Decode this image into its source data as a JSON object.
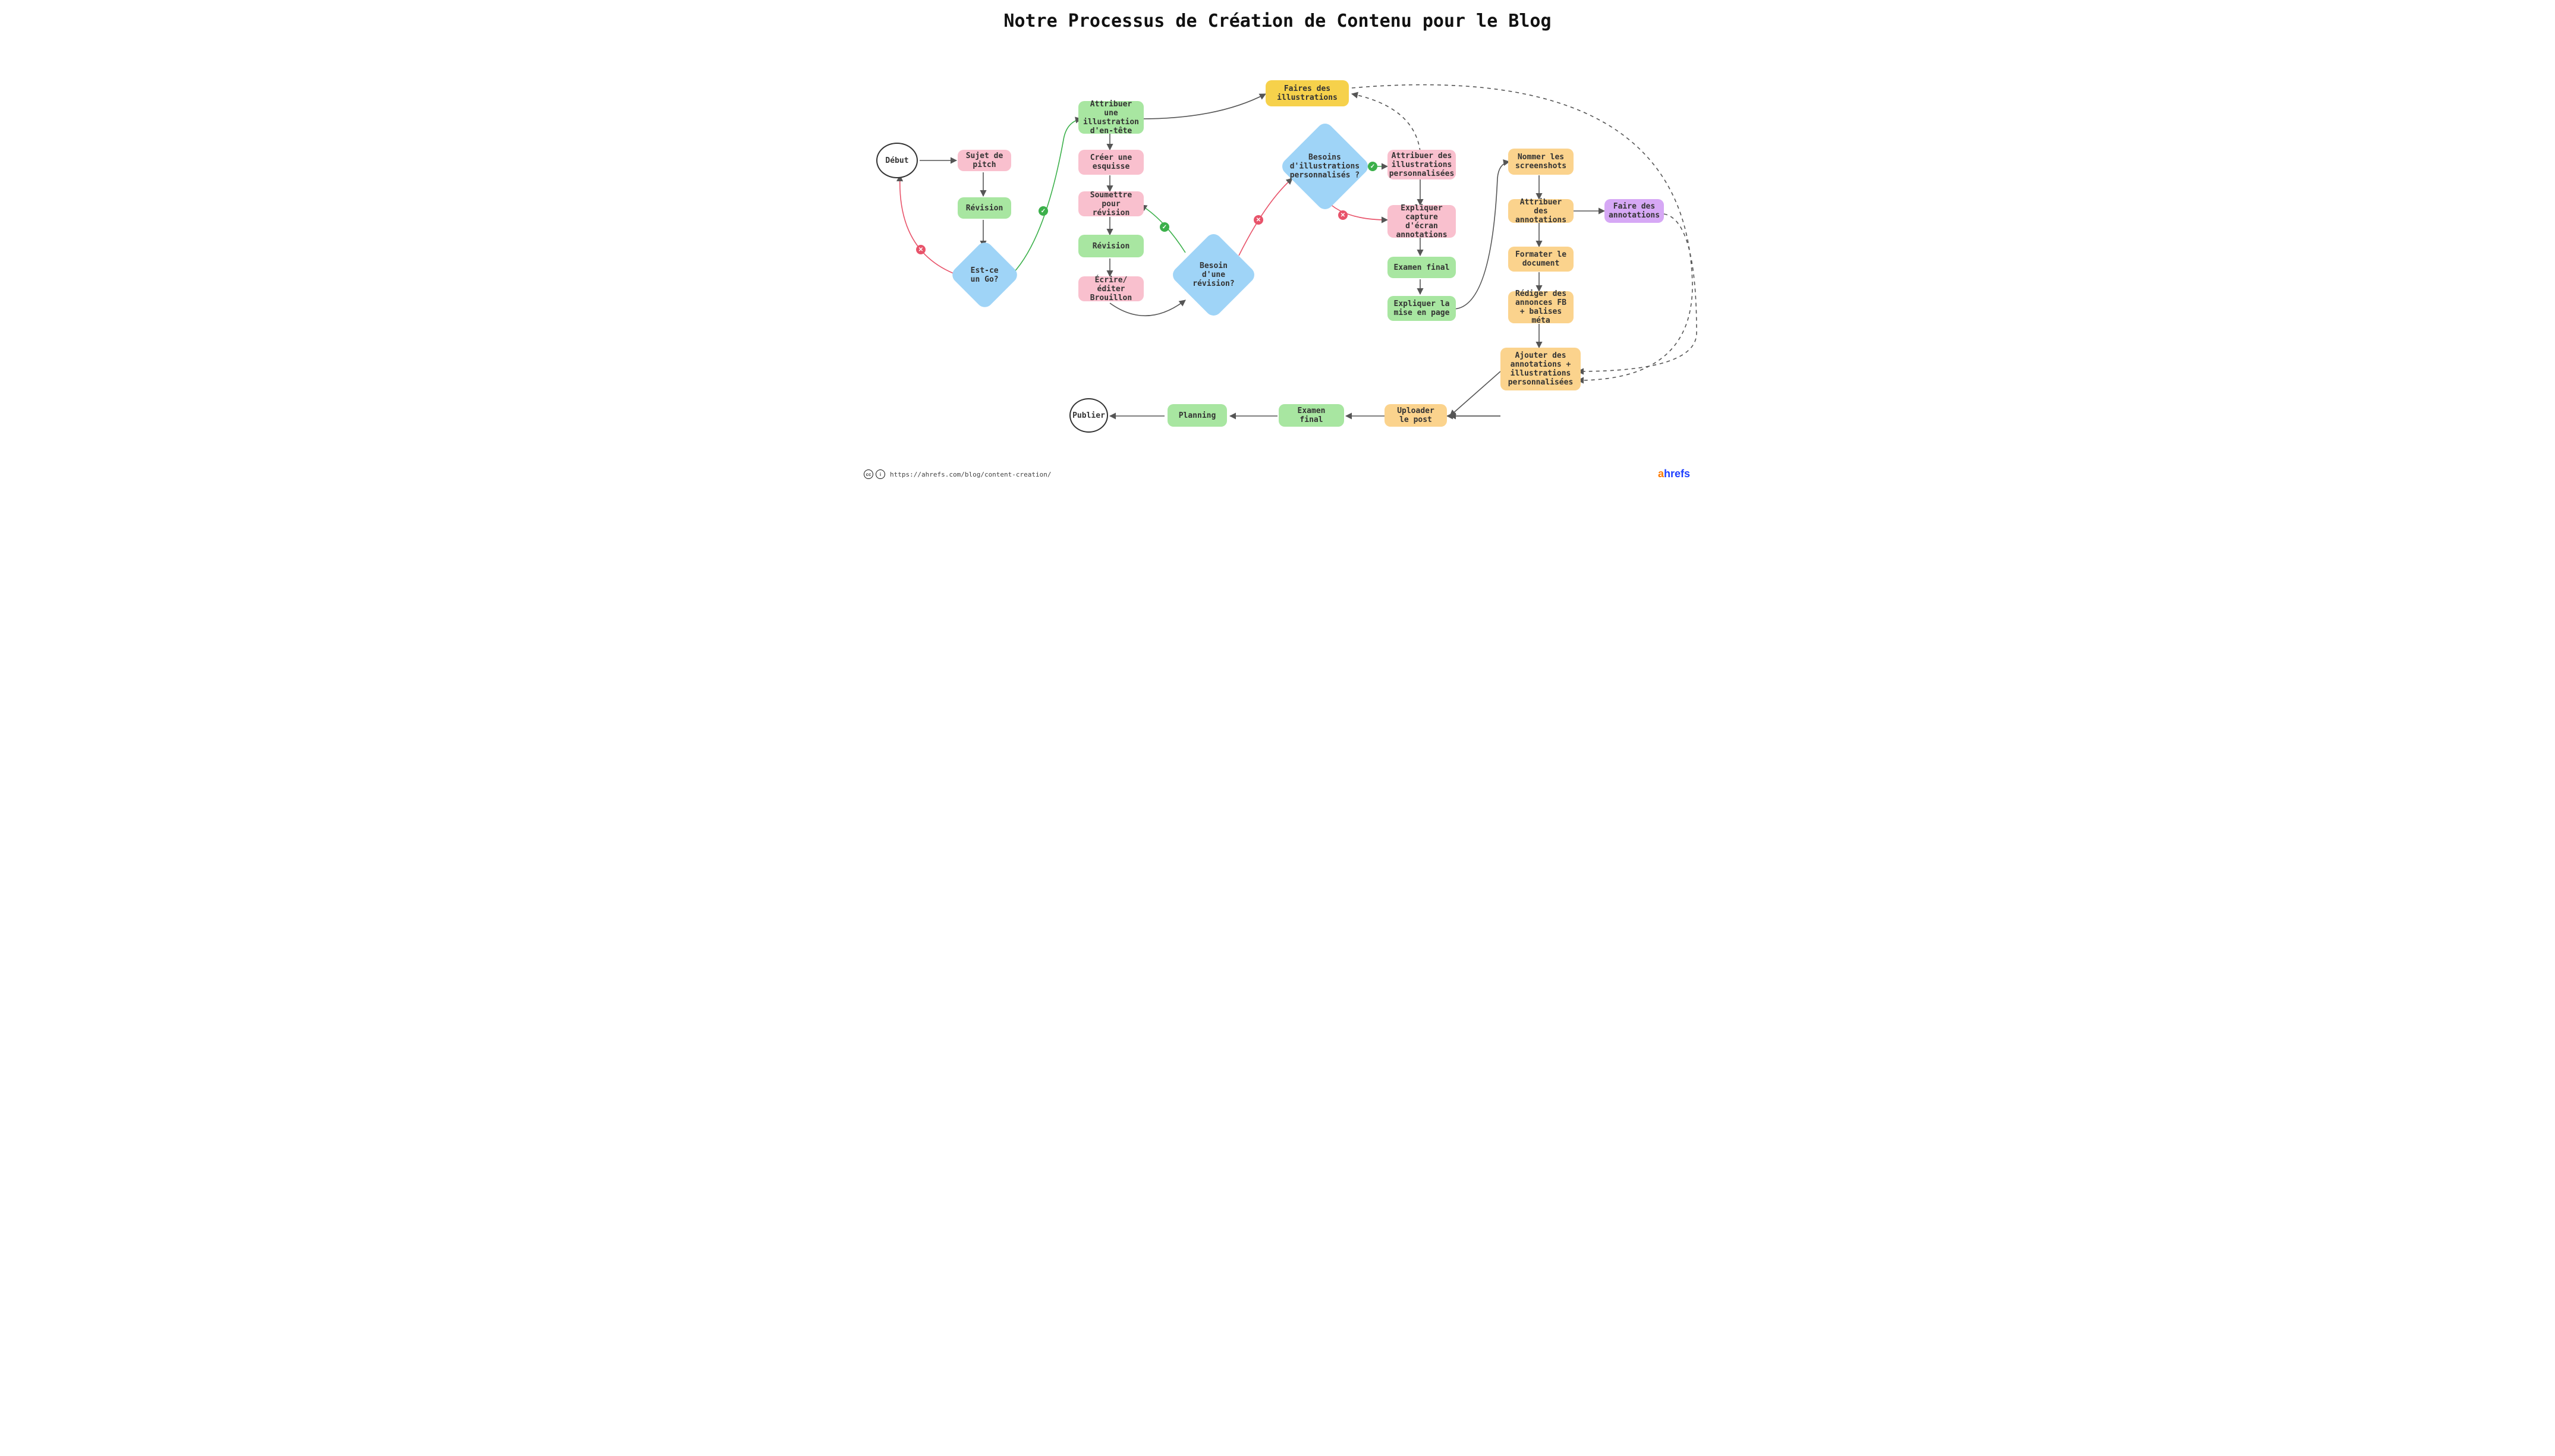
{
  "title": "Notre Processus de  Création de Contenu pour le Blog",
  "footer": {
    "url": "https://ahrefs.com/blog/content-creation/",
    "cc": "cc",
    "by": "i"
  },
  "brand": {
    "a": "a",
    "rest": "hrefs"
  },
  "nodes": {
    "start": "Début",
    "pitch": "Sujet de pitch",
    "review1": "Révision",
    "is_go": "Est-ce un Go?",
    "assign_header": "Attribuer  une illustration d'en-tête",
    "create_outline": "Créer une esquisse",
    "submit_review": "Soumettre pour révision",
    "review2": "Révision",
    "write_draft": "Écrire/éditer Brouillon",
    "need_rev": "Besoin d'une révision?",
    "make_illus": "Faires des illustrations",
    "need_custom": "Besoins d'illustrations personnalisés ?",
    "assign_custom": "Attribuer des illustrations personnalisées",
    "explain_screens": "Expliquer capture d'écran annotations",
    "final_review": "Examen final",
    "explain_layout": "Expliquer la mise en page",
    "name_screens": "Nommer les screenshots",
    "assign_annot": "Attribuer des annotations",
    "do_annot": "Faire des annotations",
    "format_doc": "Formater le document",
    "write_fb": "Rédiger des annonces FB + balises méta",
    "add_annot": "Ajouter des annotations + illustrations personnalisées",
    "upload": "Uploader le post",
    "final_review2": "Examen final",
    "planning": "Planning",
    "publish": "Publier"
  }
}
